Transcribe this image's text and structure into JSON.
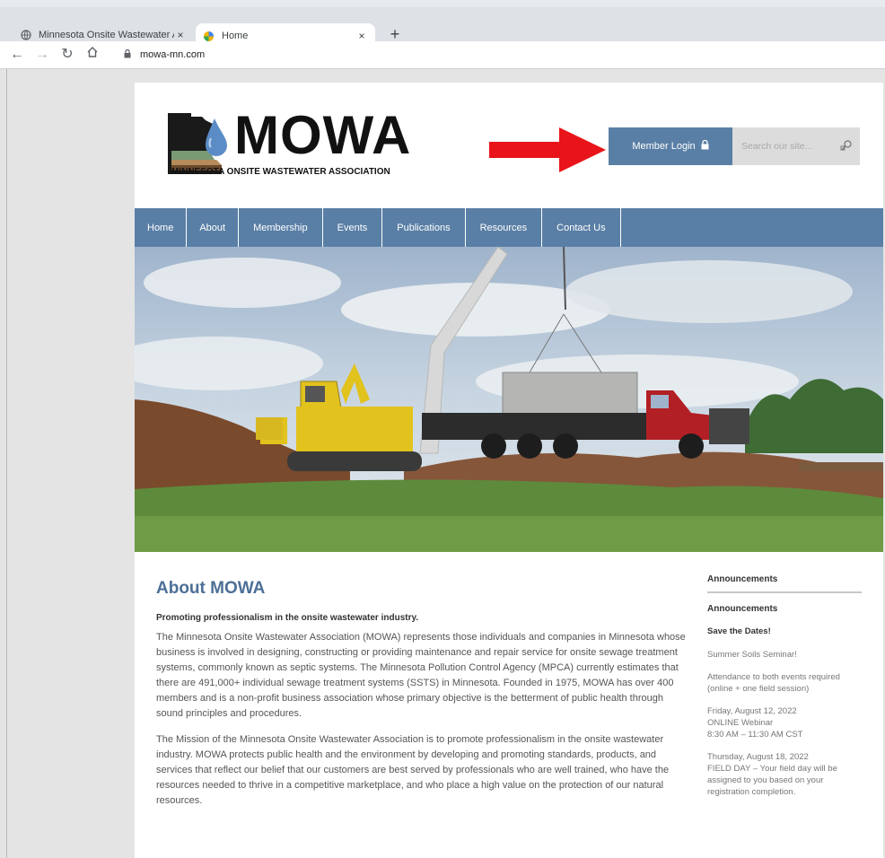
{
  "browser": {
    "tabs": [
      {
        "label": "Minnesota Onsite Wastewater As",
        "icon": "globe-icon"
      },
      {
        "label": "Home",
        "icon": "site-favicon"
      }
    ],
    "new_tab": "+",
    "close": "×",
    "url": "mowa-mn.com"
  },
  "header": {
    "logo_text": "MOWA",
    "logo_subtitle": "MINNESOTA ONSITE WASTEWATER ASSOCIATION",
    "member_login": "Member Login",
    "search_placeholder": "Search our site..."
  },
  "nav": {
    "items": [
      "Home",
      "About",
      "Membership",
      "Events",
      "Publications",
      "Resources",
      "Contact Us"
    ]
  },
  "main": {
    "title": "About MOWA",
    "tagline": "Promoting professionalism in the onsite wastewater industry.",
    "paragraph1": "The Minnesota Onsite Wastewater Association (MOWA) represents those individuals and companies in Minnesota whose business is involved in designing, constructing or providing maintenance and repair service for onsite sewage treatment systems, commonly known as septic systems. The Minnesota Pollution Control Agency (MPCA) currently estimates that there are 491,000+ individual sewage treatment systems (SSTS) in Minnesota. Founded in 1975, MOWA has over 400 members and is a non-profit business association whose primary objective is the betterment of public health through sound principles and procedures.",
    "paragraph2": "The Mission of the Minnesota Onsite Wastewater Association is to promote professionalism in the onsite wastewater industry. MOWA protects public health and the environment by developing and promoting standards, products, and services that reflect our belief that our customers are best served by professionals who are well trained, who have the resources needed to thrive in a competitive marketplace, and who place a high value on the protection of our natural resources."
  },
  "sidebar": {
    "title": "Announcements",
    "subtitle": "Announcements",
    "save_dates": "Save the Dates!",
    "seminar": "Summer Soils Seminar!",
    "attendance": "Attendance to both events required (online + one field session)",
    "event1_date": "Friday, August 12, 2022",
    "event1_type": "ONLINE Webinar",
    "event1_time": "8:30 AM – 11:30 AM CST",
    "event2_date": "Thursday, August 18, 2022",
    "event2_desc": "FIELD DAY – Your field day will be assigned to you based on your registration completion."
  },
  "colors": {
    "accent": "#5a7fa6",
    "heading": "#4c6f96",
    "arrow": "#e8141a"
  }
}
